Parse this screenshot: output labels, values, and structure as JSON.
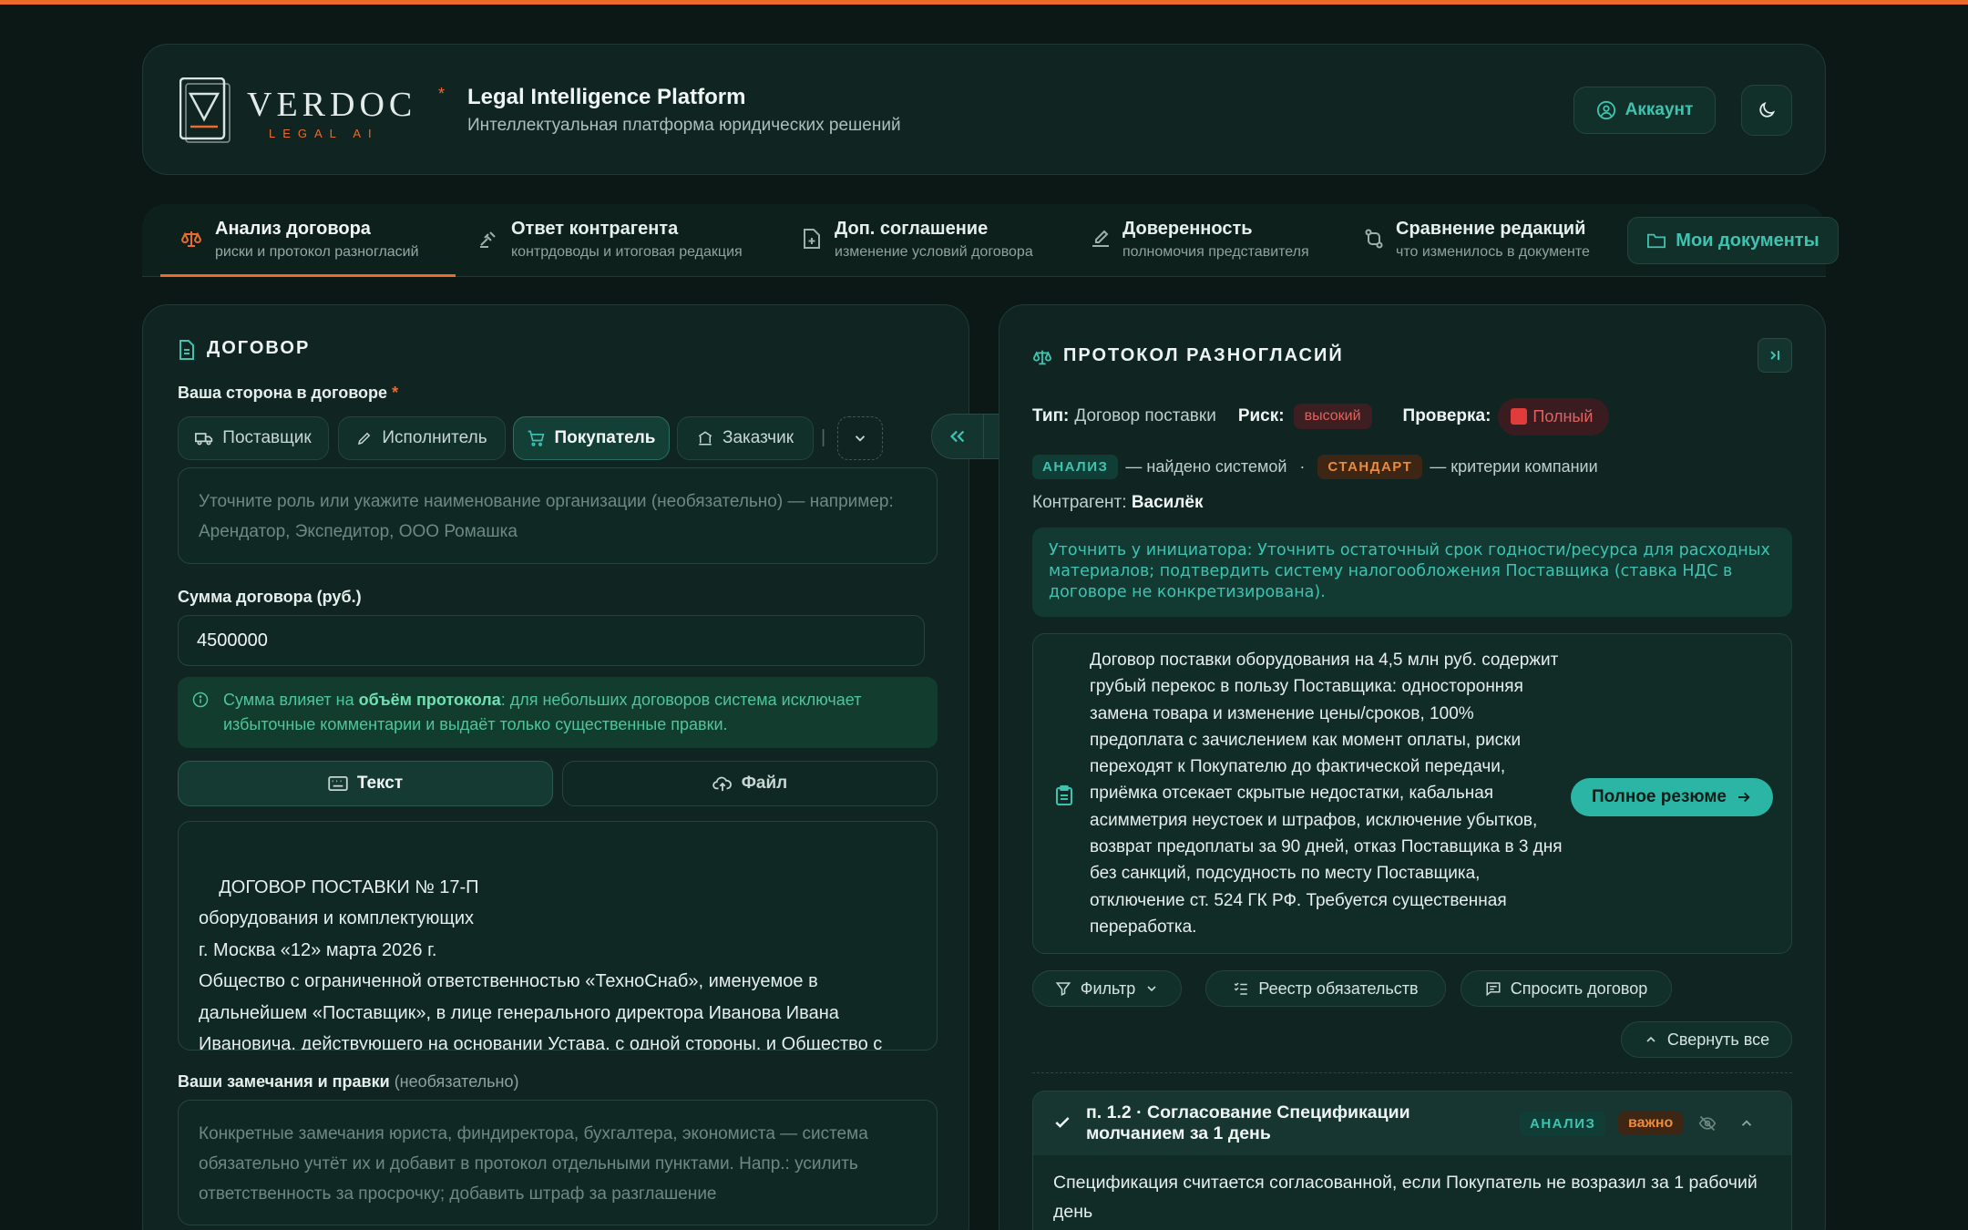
{
  "brand": {
    "name": "VERDOC",
    "sub": "LEGAL AI",
    "title": "Legal Intelligence Platform",
    "subtitle": "Интеллектуальная платформа юридических решений"
  },
  "header": {
    "account_label": "Аккаунт"
  },
  "tabs": [
    {
      "title": "Анализ договора",
      "sub": "риски и протокол разногласий"
    },
    {
      "title": "Ответ контрагента",
      "sub": "контрдоводы и итоговая редакция"
    },
    {
      "title": "Доп. соглашение",
      "sub": "изменение условий договора"
    },
    {
      "title": "Доверенность",
      "sub": "полномочия представителя"
    },
    {
      "title": "Сравнение редакций",
      "sub": "что изменилось в документе"
    }
  ],
  "my_docs_label": "Мои документы",
  "left": {
    "title": "ДОГОВОР",
    "side_label": "Ваша сторона в договоре",
    "required_mark": "*",
    "roles": [
      "Поставщик",
      "Исполнитель",
      "Покупатель",
      "Заказчик"
    ],
    "role_sep": "|",
    "role_placeholder": "Уточните роль или укажите наименование организации (необязательно) — например: Арендатор, Экспедитор, ООО Ромашка",
    "sum_label": "Сумма договора (руб.)",
    "sum_value": "4500000",
    "info_pre": "Сумма влияет на ",
    "info_bold": "объём протокола",
    "info_post": ": для небольших договоров система исключает избыточные комментарии и выдаёт только существенные правки.",
    "mode_text": "Текст",
    "mode_file": "Файл",
    "contract_text": "ДОГОВОР ПОСТАВКИ № 17-П\nоборудования и комплектующих\nг. Москва «12» марта 2026 г.\nОбщество с ограниченной ответственностью «ТехноСнаб», именуемое в дальнейшем «Поставщик», в лице генерального директора Иванова Ивана Ивановича, действующего на основании Устава, с одной стороны, и Общество с ограниченной ответственностью «Ромашка», именуемое в",
    "remarks_label": "Ваши замечания и правки",
    "remarks_optional": "(необязательно)",
    "remarks_placeholder": "Конкретные замечания юриста, финдиректора, бухгалтера, экономиста — система обязательно учтёт их и добавит в протокол отдельными пунктами. Напр.: усилить ответственность за просрочку; добавить штраф за разглашение"
  },
  "right": {
    "title": "ПРОТОКОЛ РАЗНОГЛАСИЙ",
    "type_label": "Тип:",
    "type_value": "Договор поставки",
    "risk_label": "Риск:",
    "risk_value": "высокий",
    "check_label": "Проверка:",
    "check_value": "Полный",
    "legend_analysis": "АНАЛИЗ",
    "legend_analysis_text": "— найдено системой",
    "legend_dot": "·",
    "legend_standard": "СТАНДАРТ",
    "legend_standard_text": "— критерии компании",
    "counterparty_label": "Контрагент:",
    "counterparty_value": "Василёк",
    "clarify": "Уточнить у инициатора: Уточнить остаточный срок годности/ресурса для расходных материалов; подтвердить систему налогообложения Поставщика (ставка НДС в договоре не конкретизирована).",
    "summary": "Договор поставки оборудования на 4,5 млн руб. содержит грубый перекос в пользу Поставщика: односторонняя замена товара и изменение цены/сроков, 100% предоплата с зачислением как момент оплаты, риски переходят к Покупателю до фактической передачи, приёмка отсекает скрытые недостатки, кабальная асимметрия неустоек и штрафов, исключение убытков, возврат предоплаты за 90 дней, отказ Поставщика в 3 дня без санкций, подсудность по месту Поставщика, отключение ст. 524 ГК РФ. Требуется существенная переработка.",
    "full_summary": "Полное резюме",
    "filter": "Фильтр",
    "registry": "Реестр обязательств",
    "ask": "Спросить договор",
    "collapse": "Свернуть все",
    "item_title": "п. 1.2 · Согласование Спецификации молчанием за 1 день",
    "item_tag": "АНАЛИЗ",
    "item_badge": "важно",
    "item_text": "Спецификация считается согласованной, если Покупатель не возразил за 1 рабочий день"
  },
  "colors": {
    "accent": "#2bb5a4",
    "orange": "#ec6a2c",
    "danger": "#e0625d"
  }
}
